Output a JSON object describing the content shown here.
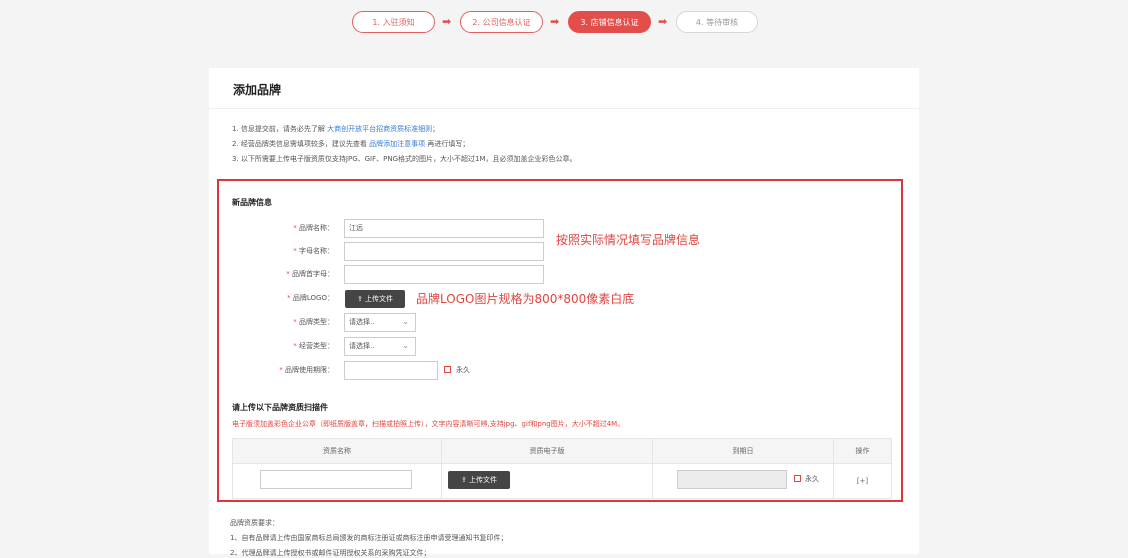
{
  "steps": [
    {
      "label": "1. 入驻须知"
    },
    {
      "label": "2. 公司信息认证"
    },
    {
      "label": "3. 店铺信息认证"
    },
    {
      "label": "4. 等待审核"
    }
  ],
  "card": {
    "title": "添加品牌",
    "notes": {
      "n1_pre": "1. 信息提交前，请务必先了解",
      "n1_link": "大商创开放平台招商资质标准细则",
      "n1_post": "；",
      "n2_pre": "2. 经营品牌类信息需填项较多，建议先查看",
      "n2_link": "品牌添加注意事项",
      "n2_post": "再进行填写；",
      "n3": "3. 以下所需要上传电子版资质仅支持JPG、GIF、PNG格式的图片，大小不超过1M，且必须加盖企业彩色公章。"
    }
  },
  "form": {
    "section_title": "新品牌信息",
    "brand_name_label": "品牌名称：",
    "brand_name_value": "江远",
    "letter_name_label": "字母名称：",
    "first_letter_label": "品牌首字母：",
    "logo_label": "品牌LOGO：",
    "upload_label": "上传文件",
    "brand_type_label": "品牌类型：",
    "brand_type_value": "请选择..",
    "business_type_label": "经营类型：",
    "business_type_value": "请选择..",
    "usage_period_label": "品牌使用期限：",
    "forever_label": "永久"
  },
  "hints": {
    "fill_info": "按照实际情况填写品牌信息",
    "logo_spec": "品牌LOGO图片规格为800*800像素白底"
  },
  "qualification": {
    "title": "请上传以下品牌资质扫描件",
    "note": "电子版须加盖彩色企业公章（即纸质版盖章，扫描或拍照上传），文字内容清晰可辨,支持jpg、gif和png图片，大小不超过4M。",
    "headers": [
      "资质名称",
      "资质电子版",
      "到期日",
      "操作"
    ],
    "upload_label": "上传文件",
    "forever_label": "永久",
    "add_label": "[+]"
  },
  "requirements": {
    "title": "品牌资质要求：",
    "line1": "1、自有品牌请上传由国家商标总局颁发的商标注册证或商标注册申请受理通知书复印件；",
    "line2": "2、代理品牌请上传授权书或邮件证明授权关系的采购凭证文件；"
  },
  "colors": {
    "accent": "#e34e4a",
    "link": "#3a7bd5",
    "annotation": "#e0443f"
  }
}
